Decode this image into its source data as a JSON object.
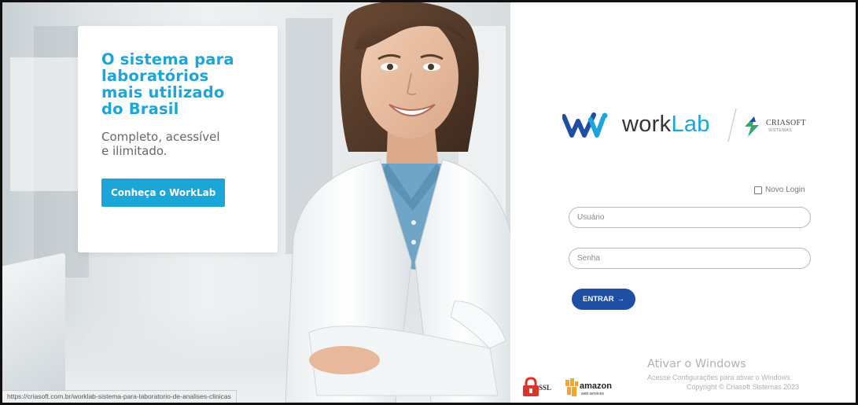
{
  "promo": {
    "title": "O sistema para\nlaboratórios\nmais utilizado\ndo Brasil",
    "subtitle": "Completo, acessível\ne ilimitado.",
    "cta_label": "Conheça o WorkLab"
  },
  "status_bar": {
    "url": "https://criasoft.com.br/worklab-sistema-para-laboratorio-de-analises-clinicas"
  },
  "brand": {
    "worklab_prefix": "work",
    "worklab_suffix": "Lab",
    "criasoft_name": "CRIASOFT",
    "criasoft_tagline": "SISTEMAS"
  },
  "login": {
    "novo_login_label": "Novo Login",
    "username_placeholder": "Usuário",
    "password_placeholder": "Senha",
    "submit_label": "ENTRAR",
    "submit_arrow": "→"
  },
  "windows_watermark": {
    "title": "Ativar o Windows",
    "subtitle": "Acesse Configurações para ativar o Windows."
  },
  "footer": {
    "copyright": "Copyright © Criasoft Sistemas 2023",
    "ssl_label": "SSL",
    "aws_label": "amazon",
    "aws_sub": "web services"
  },
  "colors": {
    "brand_blue": "#1ba5d9",
    "button_navy": "#1e4fa5",
    "criasoft_green": "#3aa56b"
  }
}
